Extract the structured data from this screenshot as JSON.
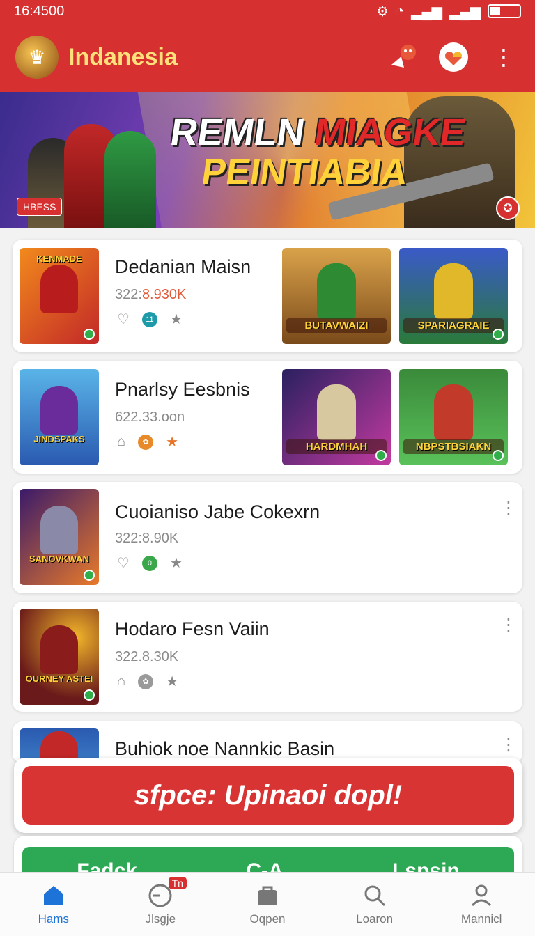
{
  "status_bar": {
    "time": "16:4500"
  },
  "app_bar": {
    "title": "Indanesia"
  },
  "banner": {
    "title_white": "REMLN",
    "title_red": "MIAGKE",
    "subtitle": "PEINTIABIA",
    "badge": "HBESS"
  },
  "cards": [
    {
      "title": "Dedanian Maisn",
      "meta_plain": "322:",
      "meta_highlight": "8.930K",
      "thumb_label": "KENMADE",
      "tiles": [
        "BUTAVWAIZI",
        "SPARIAGRAIE"
      ]
    },
    {
      "title": "Pnarlsy Eesbnis",
      "meta": "622.33.oon",
      "thumb_label": "JINDSPAKS",
      "tiles": [
        "HARDMHAH",
        "NBPSTBSIAKN"
      ]
    },
    {
      "title": "Cuoianiso Jabe Cokexrn",
      "meta": "322:8.90K",
      "thumb_label": "SANOVKWAN"
    },
    {
      "title": "Hodaro Fesn Vaiin",
      "meta": "322.8.30K",
      "thumb_label": "OURNEY ASTEI"
    },
    {
      "title": "Buhiok noe Nannkic Basin"
    }
  ],
  "promo_button": {
    "label": "sfpce: Upinaoi dopl!"
  },
  "green_bar": {
    "labels": [
      "Fadck",
      "C-A",
      "Lspsin"
    ]
  },
  "bottom_nav": {
    "items": [
      {
        "label": "Hams",
        "icon": "home-icon"
      },
      {
        "label": "Jlsgje",
        "icon": "clock-icon",
        "badge": "Tn"
      },
      {
        "label": "Oqpen",
        "icon": "bag-icon"
      },
      {
        "label": "Loaron",
        "icon": "search-icon"
      },
      {
        "label": "Mannicl",
        "icon": "profile-icon"
      }
    ]
  },
  "colors": {
    "brand_red": "#d63030",
    "title_yellow": "#ffe07a",
    "active_blue": "#1e73d8",
    "green": "#2da956"
  }
}
